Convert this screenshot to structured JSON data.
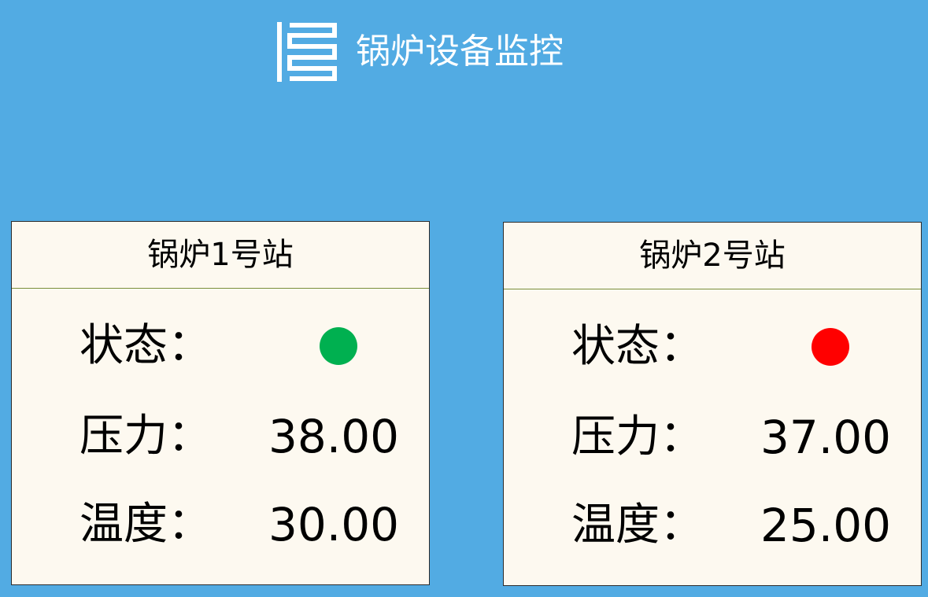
{
  "header": {
    "title": "锅炉设备监控",
    "icon": "boiler-coil-icon"
  },
  "colors": {
    "background": "#52abe3",
    "card_background": "#fdf9f0",
    "status_ok": "#00b050",
    "status_alarm": "#ff0000"
  },
  "labels": {
    "status": "状态：",
    "pressure": "压力：",
    "temperature": "温度："
  },
  "stations": [
    {
      "title": "锅炉1号站",
      "status": "running",
      "status_color": "#00b050",
      "pressure": "38.00",
      "temperature": "30.00"
    },
    {
      "title": "锅炉2号站",
      "status": "alarm",
      "status_color": "#ff0000",
      "pressure": "37.00",
      "temperature": "25.00"
    }
  ]
}
